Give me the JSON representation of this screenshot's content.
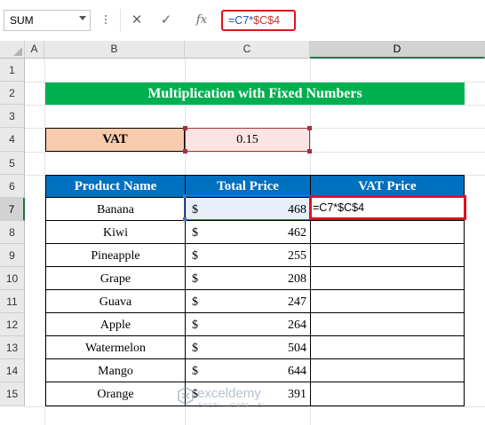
{
  "formula_bar": {
    "name_box": "SUM",
    "cancel_icon": "✕",
    "enter_icon": "✓",
    "fx_label": "fx",
    "formula_part1": "=C7*",
    "formula_part2": "$C$4"
  },
  "columns": [
    "A",
    "B",
    "C",
    "D"
  ],
  "rows": [
    "1",
    "2",
    "3",
    "4",
    "5",
    "6",
    "7",
    "8",
    "9",
    "10",
    "11",
    "12",
    "13",
    "14",
    "15"
  ],
  "sheet": {
    "title": "Multiplication with Fixed Numbers",
    "vat_label": "VAT",
    "vat_value": "0.15",
    "headers": [
      "Product Name",
      "Total Price",
      "VAT Price"
    ],
    "currency_symbol": "$",
    "active_cell_content": "=C7*$C$4",
    "items": [
      {
        "product": "Banana",
        "price": "468"
      },
      {
        "product": "Kiwi",
        "price": "462"
      },
      {
        "product": "Pineapple",
        "price": "255"
      },
      {
        "product": "Grape",
        "price": "208"
      },
      {
        "product": "Guava",
        "price": "247"
      },
      {
        "product": "Apple",
        "price": "264"
      },
      {
        "product": "Watermelon",
        "price": "504"
      },
      {
        "product": "Mango",
        "price": "644"
      },
      {
        "product": "Orange",
        "price": "391"
      }
    ]
  },
  "watermark": {
    "name": "exceldemy",
    "tagline": "EXCEL · DATA · BI"
  },
  "colors": {
    "title_bg": "#00b050",
    "header_bg": "#0070c0",
    "vat_label_bg": "#f8cbad",
    "highlight_red": "#e0121c",
    "excel_green": "#217346"
  }
}
